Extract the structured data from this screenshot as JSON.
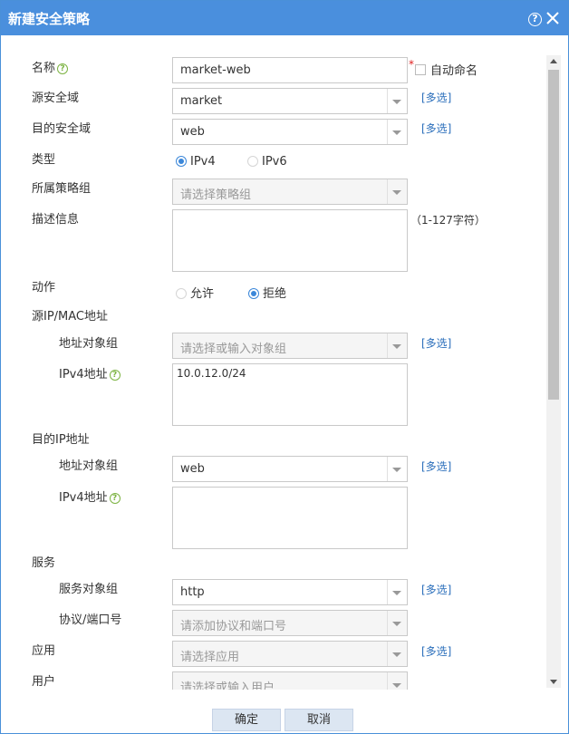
{
  "dialog": {
    "title": "新建安全策略",
    "help_glyph": "?"
  },
  "form": {
    "name": {
      "label": "名称",
      "value": "market-web",
      "required_mark": "*",
      "auto_name_label": "自动命名"
    },
    "src_zone": {
      "label": "源安全域",
      "value": "market",
      "multi": "[多选]"
    },
    "dst_zone": {
      "label": "目的安全域",
      "value": "web",
      "multi": "[多选]"
    },
    "type": {
      "label": "类型",
      "options": [
        "IPv4",
        "IPv6"
      ],
      "selected": "IPv4"
    },
    "policy_group": {
      "label": "所属策略组",
      "placeholder": "请选择策略组"
    },
    "description": {
      "label": "描述信息",
      "hint": "（1-127字符）",
      "value": ""
    },
    "action": {
      "label": "动作",
      "options": [
        "允许",
        "拒绝"
      ],
      "selected": "拒绝"
    },
    "src_addr": {
      "label": "源IP/MAC地址",
      "obj_group_label": "地址对象组",
      "obj_group_placeholder": "请选择或输入对象组",
      "multi": "[多选]",
      "ipv4_label": "IPv4地址",
      "ipv4_value": "10.0.12.0/24"
    },
    "dst_addr": {
      "label": "目的IP地址",
      "obj_group_label": "地址对象组",
      "obj_group_value": "web",
      "multi": "[多选]",
      "ipv4_label": "IPv4地址",
      "ipv4_value": ""
    },
    "service": {
      "label": "服务",
      "obj_group_label": "服务对象组",
      "obj_group_value": "http",
      "multi": "[多选]",
      "proto_label": "协议/端口号",
      "proto_placeholder": "请添加协议和端口号"
    },
    "application": {
      "label": "应用",
      "placeholder": "请选择应用",
      "multi": "[多选]"
    },
    "user": {
      "label": "用户",
      "placeholder": "请选择或输入用户"
    }
  },
  "footer": {
    "ok_label": "确定",
    "cancel_label": "取消"
  },
  "colors": {
    "titlebar": "#4a8fdd",
    "link": "#2a6ebb",
    "radio_selected": "#3b87d9",
    "help_green": "#7cb342",
    "required": "#e02020"
  }
}
